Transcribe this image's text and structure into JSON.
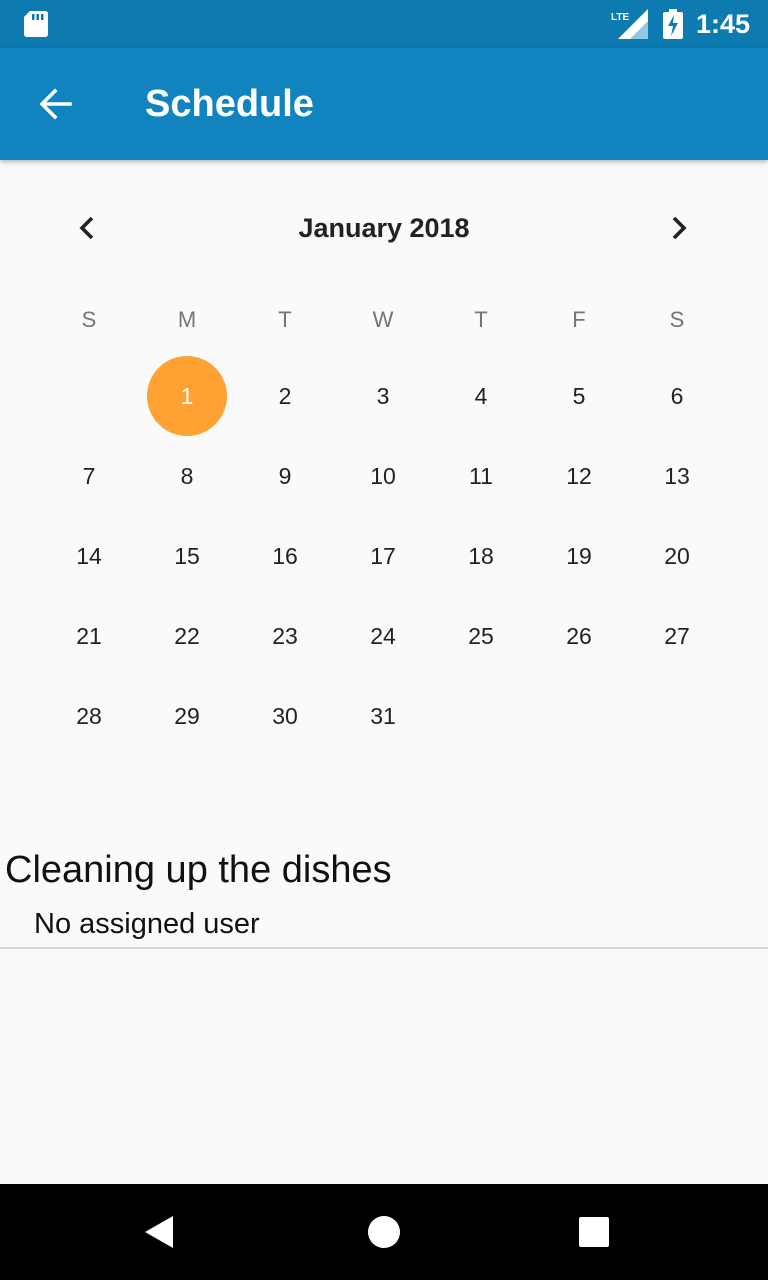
{
  "status_bar": {
    "time": "1:45",
    "network": "LTE",
    "icons": [
      "sd-card-icon",
      "lte-signal-icon",
      "battery-charging-icon"
    ]
  },
  "app_bar": {
    "title": "Schedule",
    "back_icon": "arrow-back-icon",
    "color": "#1184bf"
  },
  "calendar": {
    "month_label": "January 2018",
    "prev_icon": "chevron-left-icon",
    "next_icon": "chevron-right-icon",
    "weekdays": [
      "S",
      "M",
      "T",
      "W",
      "T",
      "F",
      "S"
    ],
    "weeks": [
      [
        "",
        "1",
        "2",
        "3",
        "4",
        "5",
        "6"
      ],
      [
        "7",
        "8",
        "9",
        "10",
        "11",
        "12",
        "13"
      ],
      [
        "14",
        "15",
        "16",
        "17",
        "18",
        "19",
        "20"
      ],
      [
        "21",
        "22",
        "23",
        "24",
        "25",
        "26",
        "27"
      ],
      [
        "28",
        "29",
        "30",
        "31",
        "",
        "",
        ""
      ]
    ],
    "selected_day": "1",
    "selected_color": "#ffa133"
  },
  "task": {
    "title": "Cleaning up the dishes",
    "assignee": "No assigned user"
  },
  "nav_bar": {
    "icons": [
      "back-triangle-icon",
      "home-circle-icon",
      "recents-square-icon"
    ]
  }
}
